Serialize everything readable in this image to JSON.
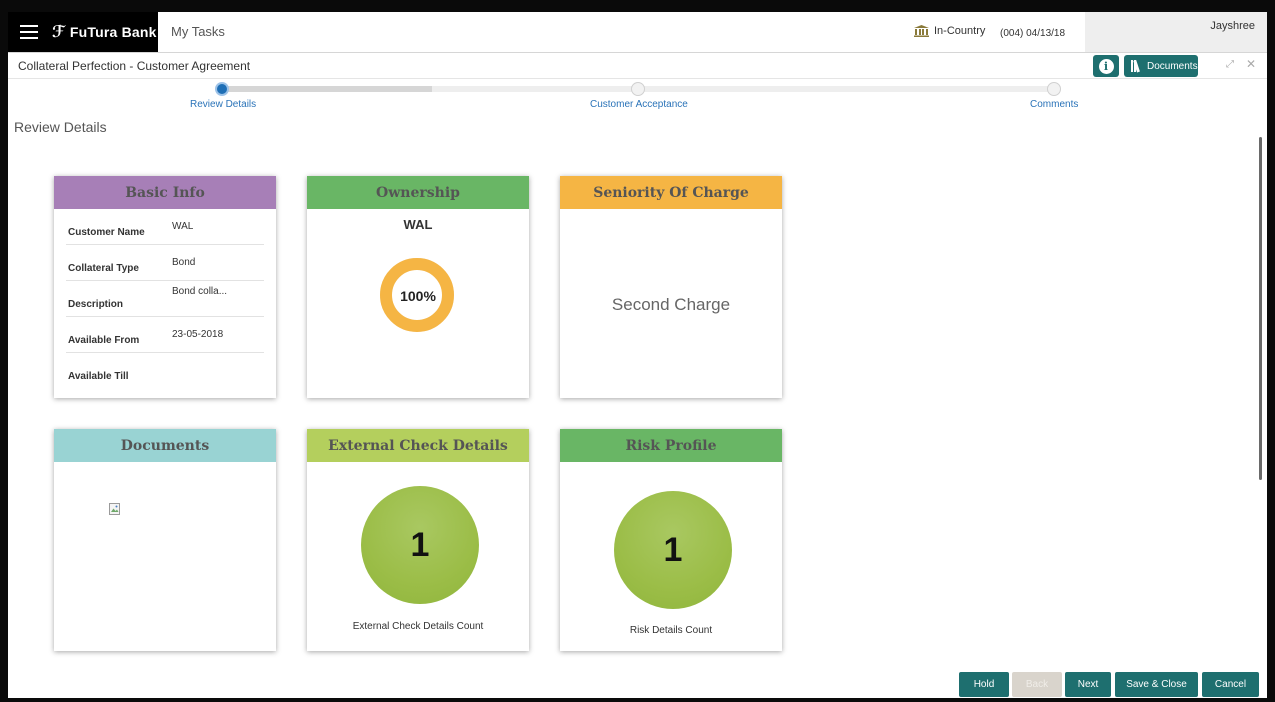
{
  "header": {
    "brand": "FuTura Bank",
    "menu_label": "My Tasks",
    "country": "In-Country",
    "branch_date": "(004)  04/13/18",
    "user": "Jayshree"
  },
  "titlebar": {
    "title": "Collateral Perfection - Customer Agreement",
    "documents_label": "Documents"
  },
  "stepper": {
    "steps": [
      {
        "label": "Review Details",
        "active": true
      },
      {
        "label": "Customer Acceptance",
        "active": false
      },
      {
        "label": "Comments",
        "active": false
      }
    ]
  },
  "section_title": "Review Details",
  "cards": {
    "basic_info": {
      "title": "Basic Info",
      "color": "#a77fb7",
      "rows": [
        {
          "label": "Customer Name",
          "value": "WAL"
        },
        {
          "label": "Collateral Type",
          "value": "Bond"
        },
        {
          "label": "Description",
          "value": "Bond colla..."
        },
        {
          "label": "Available From",
          "value": "23-05-2018"
        },
        {
          "label": "Available Till",
          "value": ""
        }
      ]
    },
    "ownership": {
      "title": "Ownership",
      "color": "#69b665",
      "owner": "WAL",
      "percent_label": "100%",
      "percent_value": 100,
      "ring_color": "#f5b544"
    },
    "seniority": {
      "title": "Seniority Of Charge",
      "color": "#f5b544",
      "value": "Second Charge"
    },
    "documents": {
      "title": "Documents",
      "color": "#99d3d3"
    },
    "external_check": {
      "title": "External Check Details",
      "color": "#b4cf5d",
      "count": "1",
      "count_label": "External Check Details Count"
    },
    "risk_profile": {
      "title": "Risk Profile",
      "color": "#69b665",
      "count": "1",
      "count_label": "Risk Details Count"
    }
  },
  "footer": {
    "hold": "Hold",
    "back": "Back",
    "next": "Next",
    "save_close": "Save & Close",
    "cancel": "Cancel"
  },
  "colors": {
    "accent": "#1e6f6f",
    "step_active": "#1f6fb6",
    "link": "#2a73b8"
  }
}
